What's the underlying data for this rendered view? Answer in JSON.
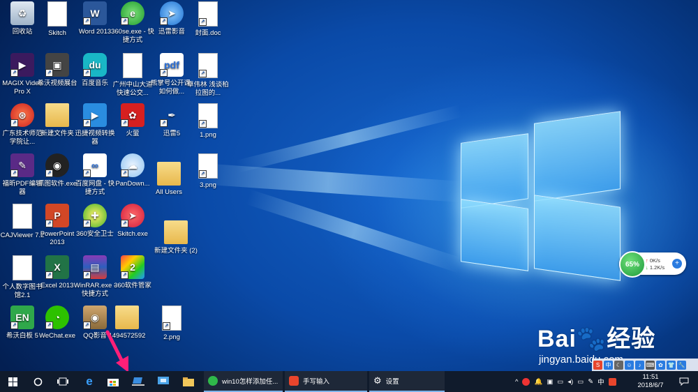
{
  "desktop": {
    "icons": [
      {
        "label": "回收站",
        "type": "recycle"
      },
      {
        "label": "Skitch",
        "type": "doc"
      },
      {
        "label": "Word 2013",
        "type": "word"
      },
      {
        "label": "360se.exe - 快捷方式",
        "type": "ie360"
      },
      {
        "label": "迅雷影音",
        "type": "xunlei"
      },
      {
        "label": "封面.doc",
        "type": "docw"
      },
      {
        "label": "MAGIX Video Pro X",
        "type": "magix"
      },
      {
        "label": "希沃视频展台",
        "type": "camera"
      },
      {
        "label": "百度音乐",
        "type": "music"
      },
      {
        "label": "广州中山大道快速公交...",
        "type": "doc"
      },
      {
        "label": "熊掌号公开课-如何做...",
        "type": "pdf"
      },
      {
        "label": "卓伟林 浅谈柏拉图的...",
        "type": "docw"
      },
      {
        "label": "广东技术师范学院让...",
        "type": "round-red"
      },
      {
        "label": "新建文件夹",
        "type": "folder"
      },
      {
        "label": "迅捷视频转换器",
        "type": "video"
      },
      {
        "label": "火萤",
        "type": "fire"
      },
      {
        "label": "迅雷5",
        "type": "feather"
      },
      {
        "label": "1.png",
        "type": "png"
      },
      {
        "label": "福昕PDF编辑器",
        "type": "foxit"
      },
      {
        "label": "抓图软件.exe",
        "type": "capture"
      },
      {
        "label": "百度网盘 - 快捷方式",
        "type": "baidupan"
      },
      {
        "label": "PanDown...",
        "type": "cloud"
      },
      {
        "label": "All Users",
        "type": "folder"
      },
      {
        "label": "3.png",
        "type": "png"
      },
      {
        "label": "CAJViewer 7.2",
        "type": "doc"
      },
      {
        "label": "PowerPoint 2013",
        "type": "ppt"
      },
      {
        "label": "360安全卫士",
        "type": "s360"
      },
      {
        "label": "Skitch.exe",
        "type": "skitch"
      },
      {
        "label": "新建文件夹 (2)",
        "type": "folder"
      },
      {
        "label": "个人数字图书馆2.1",
        "type": "doc"
      },
      {
        "label": "Excel 2013",
        "type": "excel"
      },
      {
        "label": "WinRAR.exe - 快捷方式",
        "type": "rar"
      },
      {
        "label": "360软件管家",
        "type": "mgr360"
      },
      {
        "label": "希沃白板 5",
        "type": "en"
      },
      {
        "label": "WeChat.exe",
        "type": "wechat"
      },
      {
        "label": "QQ影音",
        "type": "qqvideo"
      },
      {
        "label": "1494572592",
        "type": "folder"
      },
      {
        "label": "2.png",
        "type": "png"
      }
    ]
  },
  "net_widget": {
    "percent": "65%",
    "up": "0K/s",
    "down": "1.2K/s"
  },
  "watermark": {
    "brand": "Bai",
    "brand_cn": "经验",
    "url": "jingyan.baidu.com"
  },
  "taskbar": {
    "start_icon": "windows-logo-icon",
    "apps": [
      {
        "label": "win10怎样添加任...",
        "color": "#2fb84a"
      },
      {
        "label": "手写输入",
        "color": "#e8452c"
      },
      {
        "label": "设置",
        "color": "#ffffff"
      }
    ],
    "ime": "中",
    "time": "11:51",
    "date": "2018/6/7"
  }
}
